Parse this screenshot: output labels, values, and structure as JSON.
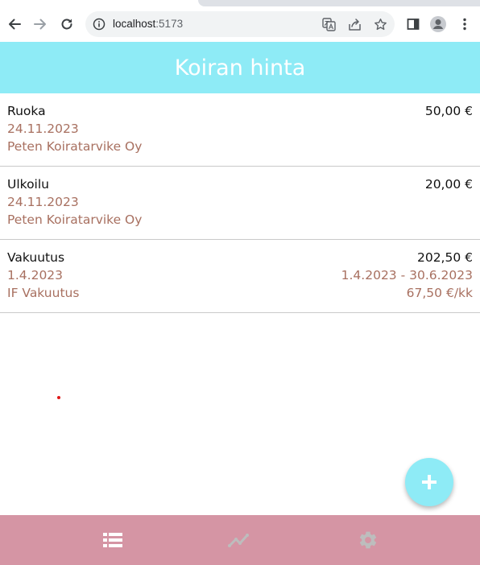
{
  "browser": {
    "url_host": "localhost",
    "url_port": ":5173"
  },
  "app": {
    "title": "Koiran hinta"
  },
  "expenses": [
    {
      "name": "Ruoka",
      "amount": "50,00 €",
      "date": "24.11.2023",
      "vendor": "Peten Koiratarvike Oy"
    },
    {
      "name": "Ulkoilu",
      "amount": "20,00 €",
      "date": "24.11.2023",
      "vendor": "Peten Koiratarvike Oy"
    },
    {
      "name": "Vakuutus",
      "amount": "202,50 €",
      "date": "1.4.2023",
      "vendor": "IF Vakuutus",
      "period": "1.4.2023 - 30.6.2023",
      "monthly": "67,50 €/kk"
    }
  ],
  "colors": {
    "header": "#8eebf6",
    "bottom_nav": "#d595a4",
    "secondary_text": "#a87060"
  },
  "icons": {
    "back": "arrow-left-icon",
    "forward": "arrow-right-icon",
    "reload": "reload-icon",
    "add": "plus-icon",
    "nav_list": "list-icon",
    "nav_chart": "trend-chart-icon",
    "nav_settings": "gear-icon"
  },
  "bottom_nav": {
    "active_index": 0
  }
}
